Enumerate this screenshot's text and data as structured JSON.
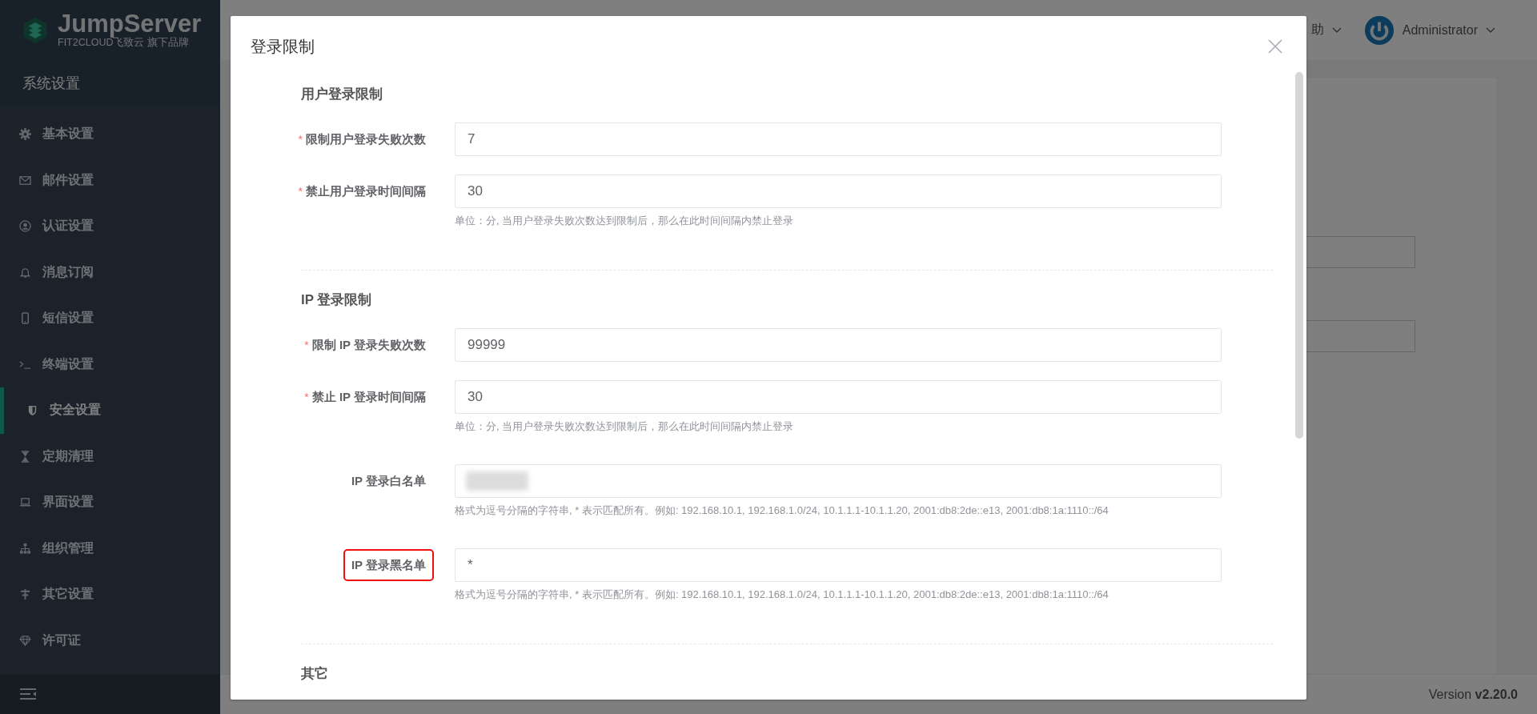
{
  "sidebar": {
    "logo": {
      "name": "JumpServer",
      "tagline": "FIT2CLOUD飞致云 旗下品牌"
    },
    "title": "系统设置",
    "items": [
      {
        "label": "基本设置",
        "selected": false
      },
      {
        "label": "邮件设置",
        "selected": false
      },
      {
        "label": "认证设置",
        "selected": false
      },
      {
        "label": "消息订阅",
        "selected": false
      },
      {
        "label": "短信设置",
        "selected": false
      },
      {
        "label": "终端设置",
        "selected": false
      },
      {
        "label": "安全设置",
        "selected": true
      },
      {
        "label": "定期清理",
        "selected": false
      },
      {
        "label": "界面设置",
        "selected": false
      },
      {
        "label": "组织管理",
        "selected": false
      },
      {
        "label": "其它设置",
        "selected": false
      },
      {
        "label": "许可证",
        "selected": false
      }
    ]
  },
  "header": {
    "help": "助",
    "user": "Administrator"
  },
  "footer": {
    "version": "Version **v2.20.0**"
  },
  "dialog": {
    "title": "登录限制",
    "sections": [
      {
        "title": "用户登录限制",
        "fields": [
          {
            "label": "限制用户登录失败次数",
            "mark": "*",
            "value": "7",
            "highlighted": false,
            "redacted": false
          },
          {
            "label": "禁止用户登录时间间隔",
            "mark": "*",
            "value": "30",
            "highlighted": false,
            "redacted": false,
            "hint": "单位：分, 当用户登录失败次数达到限制后，那么在此时间间隔内禁止登录"
          }
        ]
      },
      {
        "title": "IP 登录限制",
        "fields": [
          {
            "label": "限制 IP 登录失败次数",
            "mark": "*",
            "value": "99999",
            "highlighted": false,
            "redacted": false
          },
          {
            "label": "禁止 IP 登录时间间隔",
            "mark": "*",
            "value": "30",
            "highlighted": false,
            "redacted": false,
            "hint": "单位：分, 当用户登录失败次数达到限制后，那么在此时间间隔内禁止登录"
          },
          {
            "label": "IP 登录白名单",
            "highlighted": false,
            "redacted": true,
            "hint": "格式为逗号分隔的字符串, * 表示匹配所有。例如: 192.168.10.1, 192.168.1.0/24, 10.1.1.1-10.1.1.20, 2001:db8:2de::e13, 2001:db8:1a:1110::/64"
          },
          {
            "label": "IP 登录黑名单",
            "highlighted": true,
            "redacted": false,
            "value": "*",
            "hint": "格式为逗号分隔的字符串, * 表示匹配所有。例如: 192.168.10.1, 192.168.1.0/24, 10.1.1.1-10.1.1.20, 2001:db8:2de::e13, 2001:db8:1a:1110::/64"
          }
        ]
      },
      {
        "title": "其它"
      }
    ]
  }
}
